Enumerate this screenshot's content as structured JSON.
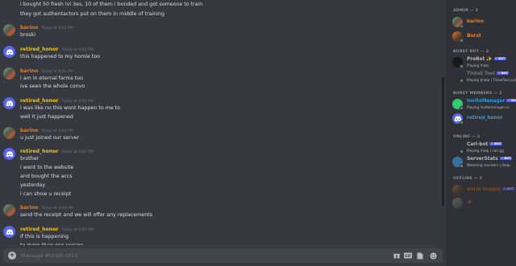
{
  "messages": [
    {
      "type": "line",
      "text": "i bought 50 fresh lvl 3es, 10 of them i bonded and got someone to train"
    },
    {
      "type": "line",
      "text": "they got authentactors put on them in middle of training"
    },
    {
      "type": "header",
      "author": "barino",
      "time": "Today at 4:02 PM",
      "avatar": "photo"
    },
    {
      "type": "line",
      "text": "broski"
    },
    {
      "type": "header",
      "author": "retired_honor",
      "time": "Today at 4:02 PM",
      "avatar": "discord"
    },
    {
      "type": "line",
      "text": "this happened to my homie too"
    },
    {
      "type": "header",
      "author": "barino",
      "time": "Today at 4:02 PM",
      "avatar": "photo"
    },
    {
      "type": "line",
      "text": "i am in eternal farms too"
    },
    {
      "type": "line",
      "text": "ive seen the whole convo"
    },
    {
      "type": "header",
      "author": "retired_honor",
      "time": "Today at 4:02 PM",
      "avatar": "discord"
    },
    {
      "type": "line",
      "text": "i was like no this wont happen to me to"
    },
    {
      "type": "line",
      "text": "well it just happened"
    },
    {
      "type": "header",
      "author": "barino",
      "time": "Today at 4:03 PM",
      "avatar": "photo"
    },
    {
      "type": "line",
      "text": "u just joined our server"
    },
    {
      "type": "header",
      "author": "retired_honor",
      "time": "Today at 4:03 PM",
      "avatar": "discord"
    },
    {
      "type": "line",
      "text": "brother"
    },
    {
      "type": "line",
      "text": "i went to the website"
    },
    {
      "type": "line",
      "text": "and bought the accs"
    },
    {
      "type": "line",
      "text": "yesterday"
    },
    {
      "type": "line",
      "text": "i can show u receipt"
    },
    {
      "type": "header",
      "author": "barino",
      "time": "Today at 4:04 PM",
      "avatar": "photo"
    },
    {
      "type": "line",
      "text": "send the receipt and we will offer any replacements"
    },
    {
      "type": "header",
      "author": "retired_honor",
      "time": "Today at 4:07 PM",
      "avatar": "discord"
    },
    {
      "type": "line",
      "text": "if this is happening"
    },
    {
      "type": "line",
      "text": "to more than one person"
    }
  ],
  "composer": {
    "placeholder": "Message #ticket-0010",
    "tools": [
      "gift-icon",
      "gif-icon",
      "sticker-icon",
      "emoji-icon"
    ],
    "gif_label": "GIF"
  },
  "members": {
    "admin": {
      "title": "ADMIN — 2",
      "items": [
        {
          "name": "barino",
          "color": "#e67e22",
          "status": "online",
          "avatar": "photo"
        },
        {
          "name": "Burst",
          "color": "#e67e22",
          "status": "online",
          "avatar": "photo2"
        }
      ]
    },
    "burst_bot": {
      "title": "BURST BOT — 2",
      "items": [
        {
          "name": "ProBot ✨",
          "color": "#b9bbbe",
          "activity": "Playing /help",
          "bot": true,
          "status": "online",
          "avatar": "probot"
        },
        {
          "name": "Ticket Tool",
          "color": "#72767d",
          "activity": "Playing $help | TicketTool.xyz",
          "bot": true,
          "status": "online",
          "avatar": "tickettool"
        }
      ]
    },
    "burst_members": {
      "title": "BURST MEMBERS — 2",
      "items": [
        {
          "name": "InviteManager",
          "color": "#3498db",
          "activity": "Playing invitemanager.co",
          "bot": true,
          "status": "online",
          "avatar": "invitemanager"
        },
        {
          "name": "retired_honor",
          "color": "#3498db",
          "status": "online",
          "avatar": "discord"
        }
      ]
    },
    "online": {
      "title": "ONLINE — 2",
      "items": [
        {
          "name": "Carl-bot",
          "color": "#b9bbbe",
          "activity": "Playing !help | carl.gg",
          "bot": true,
          "status": "online",
          "avatar": "carlbot"
        },
        {
          "name": "ServerStats",
          "color": "#b9bbbe",
          "activity": "Watching counters | /help",
          "bot": true,
          "status": "online",
          "avatar": "serverstats"
        }
      ]
    },
    "offline": {
      "title": "OFFLINE — 2",
      "items": [
        {
          "name": "Burst Supply",
          "color": "#e67e22",
          "bot": true,
          "avatar": "photo2"
        },
        {
          "name": "🔅",
          "color": "#e67e22",
          "avatar": "photo3"
        }
      ]
    },
    "bot_badge": "✓ BOT"
  },
  "colors": {
    "background": "#36393f",
    "sidebar": "#2f3136",
    "barino": "#e67e22",
    "retired_honor": "#f1c40f",
    "online": "#3ba55d",
    "blurple": "#5865f2"
  }
}
